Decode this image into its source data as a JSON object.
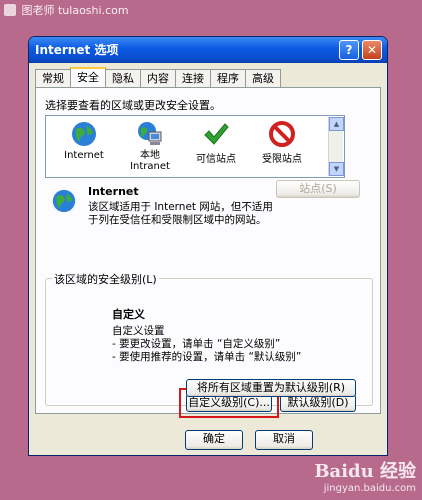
{
  "watermark_top": "图老师 tulaoshi.com",
  "window": {
    "title": "Internet 选项",
    "help_glyph": "?",
    "close_glyph": "✕"
  },
  "tabs": [
    "常规",
    "安全",
    "隐私",
    "内容",
    "连接",
    "程序",
    "高级"
  ],
  "active_tab": "安全",
  "instruction": "选择要查看的区域或更改安全设置。",
  "zones": [
    {
      "label": "Internet",
      "icon": "globe-icon"
    },
    {
      "label": "本地\nIntranet",
      "icon": "intranet-icon"
    },
    {
      "label": "可信站点",
      "icon": "checkmark-icon"
    },
    {
      "label": "受限站点",
      "icon": "restricted-icon"
    }
  ],
  "selected_zone": {
    "name": "Internet",
    "description": "该区域适用于 Internet 网站，但不适用于列在受信任和受限制区域中的网站。",
    "sites_button": "站点(S)"
  },
  "security_level": {
    "group_title": "该区域的安全级别(L)",
    "level_name": "自定义",
    "lines": [
      "自定义设置",
      "- 要更改设置，请单击 “自定义级别”",
      "- 要使用推荐的设置，请单击 “默认级别”"
    ],
    "custom_level_button": "自定义级别(C)...",
    "default_level_button": "默认级别(D)",
    "reset_all_button": "将所有区域重置为默认级别(R)"
  },
  "footer": {
    "ok": "确定",
    "cancel": "取消"
  },
  "watermark_bottom": {
    "brand": "Baidu 经验",
    "url": "jingyan.baidu.com"
  },
  "colors": {
    "background": "#b86a8d",
    "titlebar": "#0b5ae0",
    "highlight_box": "#d21a1a",
    "dialog": "#ece9d8"
  }
}
